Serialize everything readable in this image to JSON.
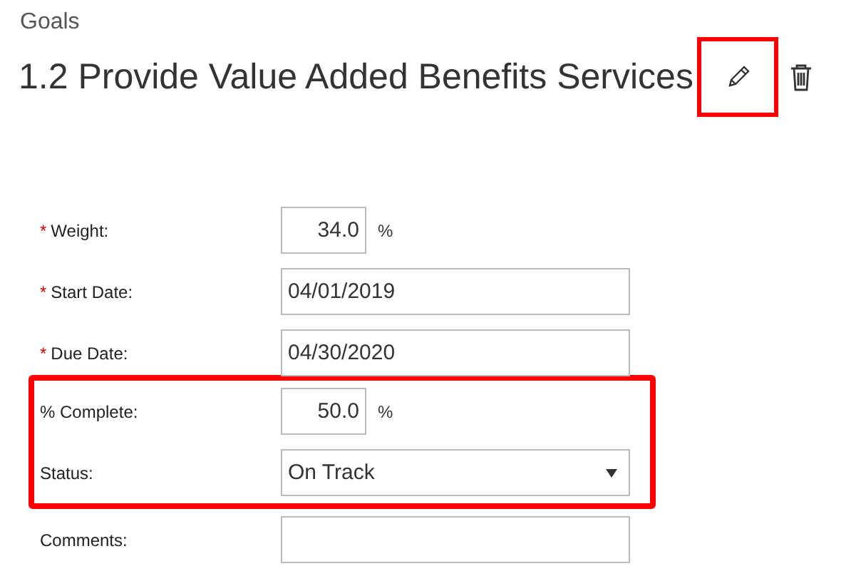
{
  "header": {
    "section": "Goals",
    "title": "1.2 Provide Value Added Benefits Services",
    "edit_highlighted": true
  },
  "form": {
    "groups": [
      {
        "highlighted": false,
        "fields": [
          {
            "kind": "number",
            "required_mark": "*",
            "label": "Weight:",
            "value": "34.0",
            "unit": "%"
          },
          {
            "kind": "text",
            "required_mark": "*",
            "label": "Start Date:",
            "value": "04/01/2019"
          },
          {
            "kind": "text",
            "required_mark": "*",
            "label": "Due Date:",
            "value": "04/30/2020"
          }
        ]
      },
      {
        "highlighted": true,
        "fields": [
          {
            "kind": "number",
            "label": "% Complete:",
            "value": "50.0",
            "unit": "%"
          },
          {
            "kind": "select",
            "label": "Status:",
            "value": "On Track"
          }
        ]
      },
      {
        "highlighted": false,
        "fields": [
          {
            "kind": "text",
            "label": "Comments:"
          }
        ]
      }
    ]
  }
}
